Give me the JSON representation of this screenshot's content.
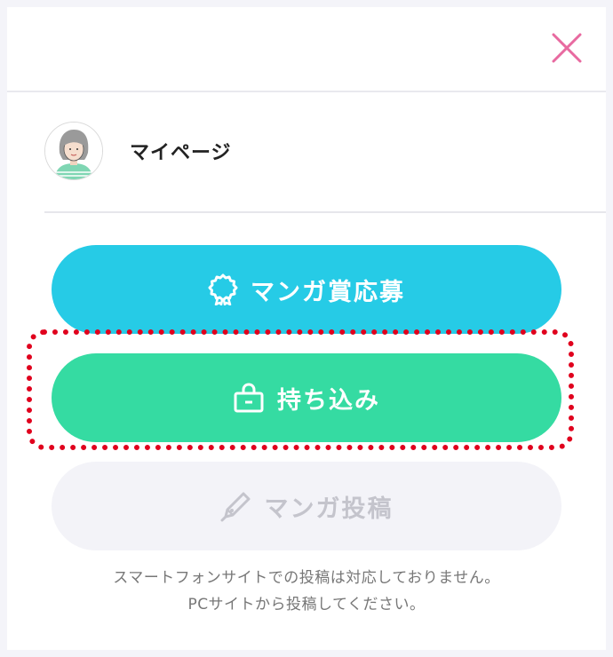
{
  "header": {
    "close_icon": "close-icon",
    "close_color": "#e86aa0"
  },
  "mypage": {
    "avatar_icon": "user-avatar",
    "label": "マイページ"
  },
  "buttons": {
    "award": {
      "label": "マンガ賞応募",
      "icon": "award-ribbon-icon",
      "color": "#26cbe6"
    },
    "bring": {
      "label": "持ち込み",
      "icon": "bag-icon",
      "color": "#35dba2"
    },
    "post": {
      "label": "マンガ投稿",
      "icon": "pen-icon",
      "color": "#f3f3f8",
      "disabled": true
    }
  },
  "highlight_color": "#e0001d",
  "note": {
    "line1": "スマートフォンサイトでの投稿は対応しておりません。",
    "line2": "PCサイトから投稿してください。"
  }
}
